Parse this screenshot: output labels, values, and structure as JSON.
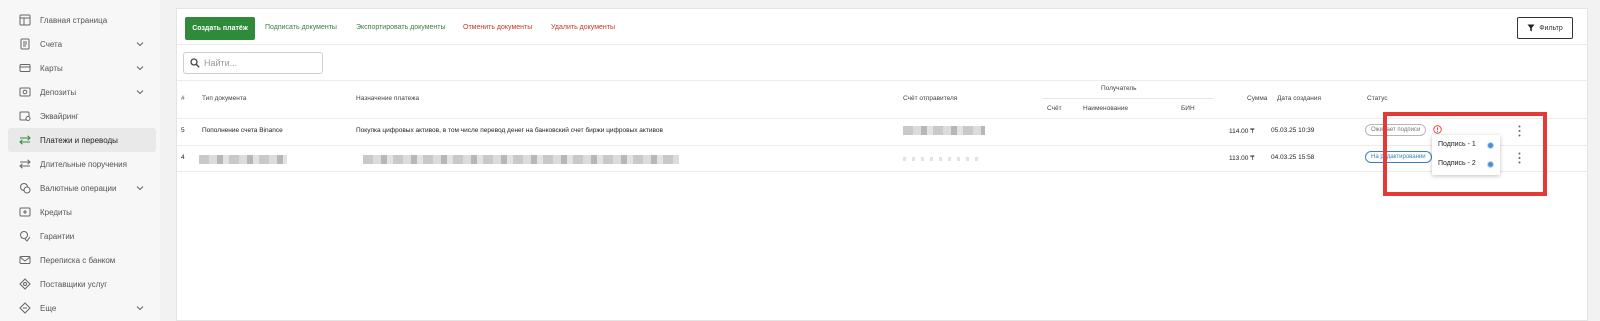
{
  "sidebar": {
    "items": [
      {
        "label": "Главная страница",
        "icon": "home-icon"
      },
      {
        "label": "Счета",
        "icon": "document-icon",
        "chevron": true
      },
      {
        "label": "Карты",
        "icon": "card-icon",
        "chevron": true
      },
      {
        "label": "Депозиты",
        "icon": "deposit-icon",
        "chevron": true
      },
      {
        "label": "Эквайринг",
        "icon": "terminal-icon"
      },
      {
        "label": "Платежи и переводы",
        "icon": "transfer-icon",
        "active": true
      },
      {
        "label": "Длительные поручения",
        "icon": "transfer-icon"
      },
      {
        "label": "Валютные операции",
        "icon": "currency-icon",
        "chevron": true
      },
      {
        "label": "Кредиты",
        "icon": "credit-icon"
      },
      {
        "label": "Гарантии",
        "icon": "guarantee-icon"
      },
      {
        "label": "Переписка с банком",
        "icon": "mail-icon"
      },
      {
        "label": "Поставщики услуг",
        "icon": "services-icon"
      },
      {
        "label": "Еще",
        "icon": "more-icon",
        "chevron": true
      }
    ]
  },
  "toolbar": {
    "create_payment": "Создать платёж",
    "sign_documents": "Подписать документы",
    "export_documents": "Экспортировать документы",
    "cancel_documents": "Отменить документы",
    "delete_documents": "Удалить документы",
    "filter": "Фильтр"
  },
  "search": {
    "placeholder": "Найти..."
  },
  "table": {
    "headers": {
      "num": "#",
      "doc_type": "Тип документа",
      "purpose": "Назначение платежа",
      "sender_account": "Счёт отправителя",
      "recipient": "Получатель",
      "recipient_account": "Счёт",
      "recipient_name": "Наименование",
      "recipient_bin": "БИН",
      "amount": "Сумма",
      "created": "Дата создания",
      "status": "Статус"
    },
    "rows": [
      {
        "num": "5",
        "doc_type": "Пополнение счета Binance",
        "purpose": "Покупка цифровых активов, в том числе перевод денег на банковский счет биржи цифровых активов",
        "amount": "114.00 ₸",
        "created": "05.03.25 10:39",
        "status": "Ожидает подписи"
      },
      {
        "num": "4",
        "amount": "113.00 ₸",
        "created": "04.03.25 15:58",
        "status": "На редактировании"
      }
    ]
  },
  "popover": {
    "items": [
      {
        "label": "Подпись - 1"
      },
      {
        "label": "Подпись - 2"
      }
    ]
  },
  "colors": {
    "accent_green": "#2f8a3a",
    "danger_red": "#c0392b",
    "status_blue": "#3f7ec7",
    "highlight_red": "#e53935"
  }
}
